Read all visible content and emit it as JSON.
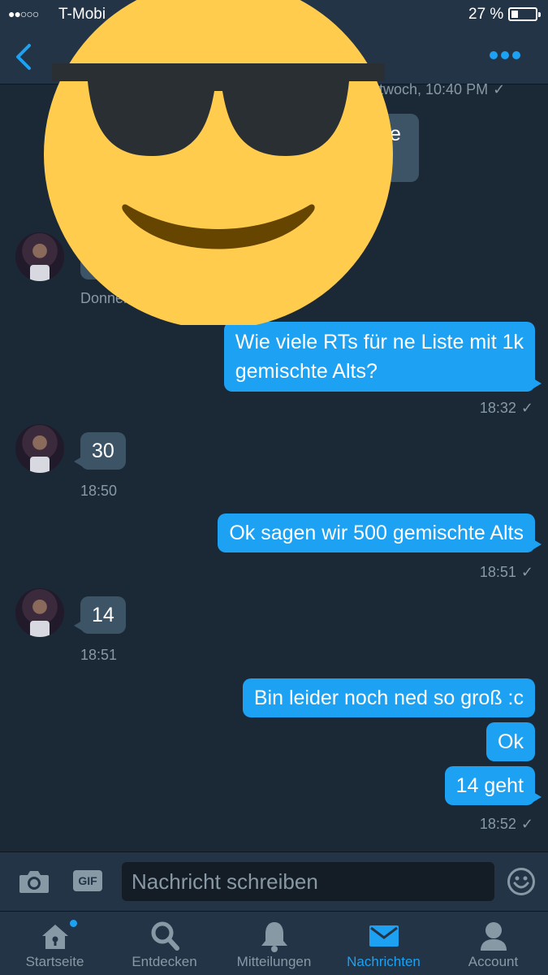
{
  "status_bar": {
    "signal": "●●○○○",
    "carrier": "T-Mobi",
    "battery_percent": "27 %",
    "battery_level": 0.27
  },
  "nav": {
    "back_icon": "chevron-left-icon",
    "more_icon": "more-dots-icon"
  },
  "messages": [
    {
      "id": "ts-top",
      "text": "ttwoch, 10:40 PM",
      "check": "✓"
    },
    {
      "id": "partial-e",
      "text": "e"
    },
    {
      "id": "ts-donner",
      "text": "Donner"
    },
    {
      "id": "out-1",
      "text": "Wie viele RTs für ne Liste mit 1k",
      "text2": "gemischte Alts?"
    },
    {
      "id": "ts-1832",
      "text": "18:32",
      "check": "✓"
    },
    {
      "id": "in-30",
      "text": "30"
    },
    {
      "id": "ts-1850",
      "text": "18:50"
    },
    {
      "id": "out-2",
      "text": "Ok sagen wir 500 gemischte Alts"
    },
    {
      "id": "ts-1851a",
      "text": "18:51",
      "check": "✓"
    },
    {
      "id": "in-14",
      "text": "14"
    },
    {
      "id": "ts-1851b",
      "text": "18:51"
    },
    {
      "id": "out-3",
      "text": "Bin leider noch ned so groß :c"
    },
    {
      "id": "out-4",
      "text": "Ok"
    },
    {
      "id": "out-5",
      "text": "14 geht"
    },
    {
      "id": "ts-1852",
      "text": "18:52",
      "check": "✓"
    }
  ],
  "compose": {
    "placeholder": "Nachricht schreiben",
    "gif_label": "GIF"
  },
  "tabs": [
    {
      "label": "Startseite",
      "icon": "home-icon",
      "has_dot": true
    },
    {
      "label": "Entdecken",
      "icon": "search-icon"
    },
    {
      "label": "Mitteilungen",
      "icon": "bell-icon"
    },
    {
      "label": "Nachrichten",
      "icon": "envelope-icon",
      "active": true
    },
    {
      "label": "Account",
      "icon": "person-icon"
    }
  ],
  "colors": {
    "background": "#1b2836",
    "bar": "#243447",
    "accent": "#1da1f2",
    "incoming_bubble": "#3d5466",
    "muted": "#8899a6",
    "emoji_face": "#ffcc4d"
  }
}
